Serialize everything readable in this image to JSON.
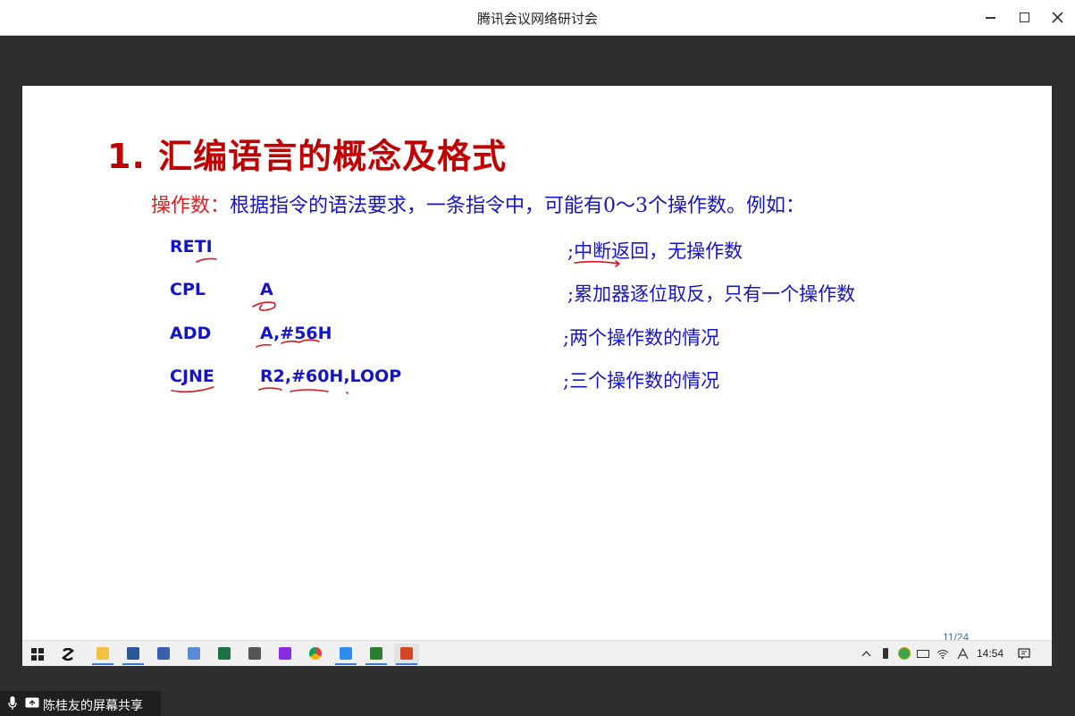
{
  "window": {
    "title": "腾讯会议网络研讨会",
    "controls": [
      "minimize",
      "maximize",
      "close"
    ]
  },
  "slide": {
    "title": "1.  汇编语言的概念及格式",
    "intro_lead": "操作数：",
    "intro_rest": "根据指令的语法要求，一条指令中，可能有0～3个操作数。例如：",
    "rows": [
      {
        "mnemonic": "RETI",
        "operands": "",
        "comment": ";中断返回，无操作数"
      },
      {
        "mnemonic": "CPL",
        "operands": "A",
        "comment": ";累加器逐位取反，只有一个操作数"
      },
      {
        "mnemonic": "ADD",
        "operands": "A,#56H",
        "comment": ";两个操作数的情况"
      },
      {
        "mnemonic": "CJNE",
        "operands": "R2,#60H,LOOP",
        "comment": ";三个操作数的情况"
      }
    ],
    "page_number": "11/24",
    "colors": {
      "title": "#c00000",
      "lead": "#e41b1b",
      "body": "#1414c8",
      "annotation": "#d8141e"
    }
  },
  "taskbar": {
    "apps": [
      "start-icon",
      "search-icon",
      "file-explorer-icon",
      "word-icon",
      "text-editor-icon",
      "remote-desktop-icon",
      "excel-icon",
      "notes-icon",
      "ebook-icon",
      "chrome-icon",
      "meeting-app-icon",
      "wechat-work-icon",
      "powerpoint-icon"
    ],
    "clock": "14:54",
    "tray": [
      "chevron-up-icon",
      "usb-icon",
      "security-shield-icon",
      "battery-icon",
      "wifi-icon",
      "input-method-icon",
      "notification-icon"
    ]
  },
  "share_status": {
    "label": "陈桂友的屏幕共享"
  }
}
